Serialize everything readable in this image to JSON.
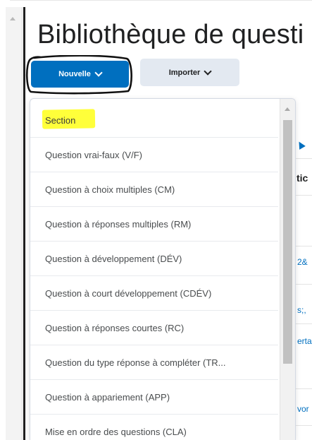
{
  "page": {
    "title": "Bibliothèque de questi"
  },
  "toolbar": {
    "new_label": "Nouvelle",
    "import_label": "Importer"
  },
  "new_menu": {
    "items": [
      {
        "label": "Section"
      },
      {
        "label": "Question vrai-faux (V/F)"
      },
      {
        "label": "Question à choix multiples (CM)"
      },
      {
        "label": "Question à réponses multiples (RM)"
      },
      {
        "label": "Question à développement (DÉV)"
      },
      {
        "label": "Question à court développement (CDÉV)"
      },
      {
        "label": "Question à réponses courtes (RC)"
      },
      {
        "label": "Question du type réponse à compléter (TR..."
      },
      {
        "label": "Question à appariement (APP)"
      },
      {
        "label": "Mise en ordre des questions (CLA)"
      }
    ]
  },
  "background_table": {
    "header_fragment": "tic",
    "cell_fragments": [
      "2&",
      "s;,",
      "erta",
      "vor"
    ]
  },
  "colors": {
    "primary_button": "#006fbf",
    "secondary_button": "#e3e9f1",
    "highlight": "#ffff3a"
  },
  "icons": {
    "dropdown_chevron": "chevron-down-icon",
    "sort_arrow": "sort-arrow-icon"
  }
}
